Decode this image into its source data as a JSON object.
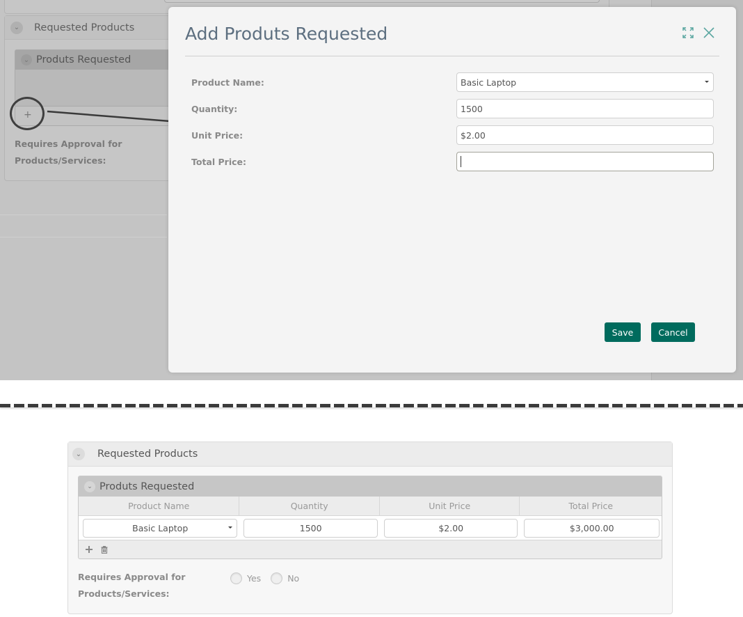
{
  "background": {
    "section_title": "Requested Products",
    "subsection_title": "Produts Requested",
    "add_icon": "+",
    "approval_label_line1": "Requires Approval for",
    "approval_label_line2": "Products/Services:"
  },
  "modal": {
    "title": "Add Produts Requested",
    "icons": [
      "expand-icon",
      "close-icon"
    ],
    "fields": [
      {
        "label": "Product Name:",
        "value": "Basic Laptop",
        "type": "select"
      },
      {
        "label": "Quantity:",
        "value": "1500",
        "type": "text"
      },
      {
        "label": "Unit Price:",
        "value": "$2.00",
        "type": "text"
      },
      {
        "label": "Total Price:",
        "value": "",
        "type": "text",
        "focused": true
      }
    ],
    "buttons": {
      "save": "Save",
      "cancel": "Cancel"
    },
    "accent_color": "#006b5d"
  },
  "result": {
    "section_title": "Requested Products",
    "subsection_title": "Produts Requested",
    "columns": [
      "Product Name",
      "Quantity",
      "Unit Price",
      "Total Price"
    ],
    "rows": [
      {
        "product_name": "Basic Laptop",
        "quantity": "1500",
        "unit_price": "$2.00",
        "total_price": "$3,000.00"
      }
    ],
    "footer_icons": [
      "add-icon",
      "trash-icon"
    ],
    "approval_label_line1": "Requires Approval for",
    "approval_label_line2": "Products/Services:",
    "approval_options": [
      "Yes",
      "No"
    ]
  }
}
